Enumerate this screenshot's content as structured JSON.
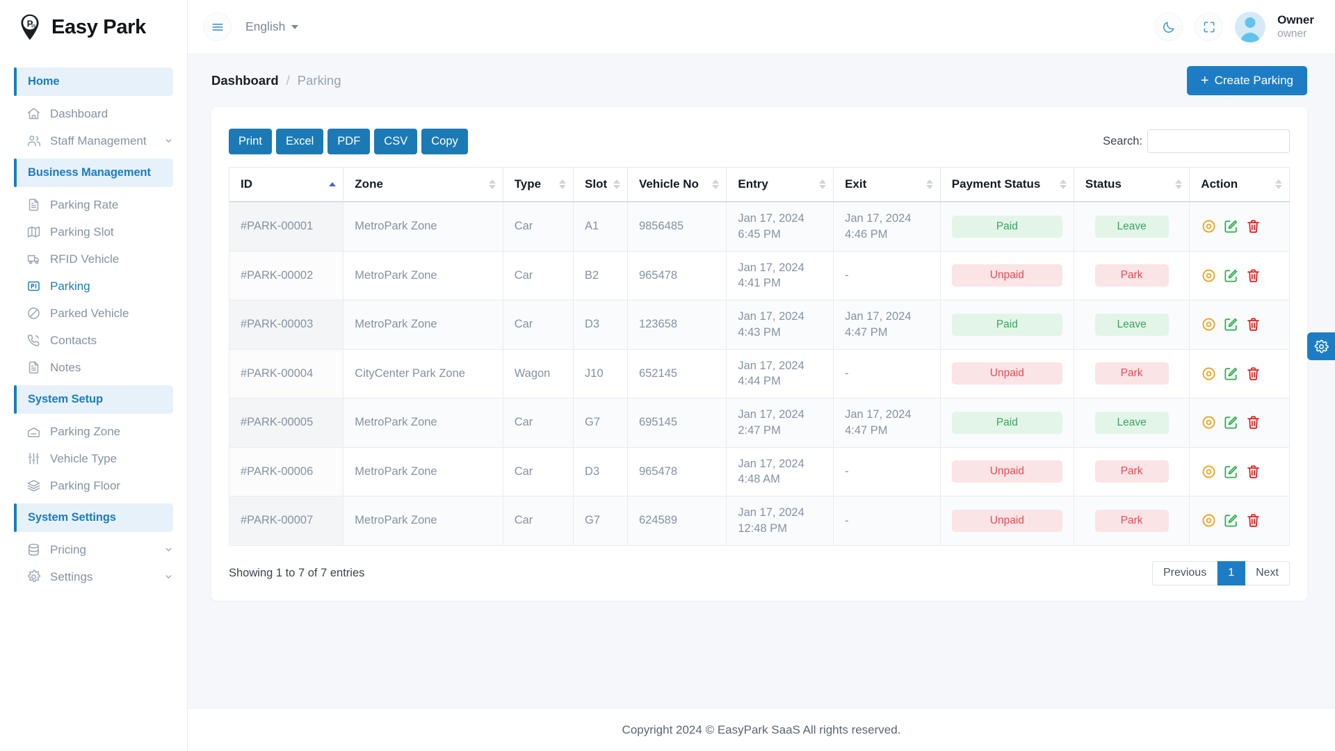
{
  "brand": {
    "name": "Easy Park",
    "logo_icon": "map-pin-parking-icon"
  },
  "sidebar": {
    "sections": [
      {
        "label": "Home",
        "items": [
          {
            "label": "Dashboard",
            "icon": "home-icon",
            "active": false,
            "expandable": false
          },
          {
            "label": "Staff Management",
            "icon": "users-icon",
            "active": false,
            "expandable": true
          }
        ]
      },
      {
        "label": "Business Management",
        "items": [
          {
            "label": "Parking Rate",
            "icon": "file-text-icon",
            "active": false,
            "expandable": false
          },
          {
            "label": "Parking Slot",
            "icon": "map-icon",
            "active": false,
            "expandable": false
          },
          {
            "label": "RFID Vehicle",
            "icon": "truck-icon",
            "active": false,
            "expandable": false
          },
          {
            "label": "Parking",
            "icon": "parking-card-icon",
            "active": true,
            "expandable": false
          },
          {
            "label": "Parked Vehicle",
            "icon": "no-entry-icon",
            "active": false,
            "expandable": false
          },
          {
            "label": "Contacts",
            "icon": "phone-call-icon",
            "active": false,
            "expandable": false
          },
          {
            "label": "Notes",
            "icon": "file-text-icon",
            "active": false,
            "expandable": false
          }
        ]
      },
      {
        "label": "System Setup",
        "items": [
          {
            "label": "Parking Zone",
            "icon": "garage-icon",
            "active": false,
            "expandable": false
          },
          {
            "label": "Vehicle Type",
            "icon": "sliders-icon",
            "active": false,
            "expandable": false
          },
          {
            "label": "Parking Floor",
            "icon": "layers-icon",
            "active": false,
            "expandable": false
          }
        ]
      },
      {
        "label": "System Settings",
        "items": [
          {
            "label": "Pricing",
            "icon": "database-icon",
            "active": false,
            "expandable": true
          },
          {
            "label": "Settings",
            "icon": "gear-icon",
            "active": false,
            "expandable": true
          }
        ]
      }
    ]
  },
  "topbar": {
    "menu_icon": "hamburger-icon",
    "language": "English",
    "dark_mode_icon": "moon-icon",
    "fullscreen_icon": "expand-icon",
    "user": {
      "name": "Owner",
      "role": "owner"
    }
  },
  "page": {
    "breadcrumb": {
      "current": "Dashboard",
      "separator": "/",
      "sub": "Parking"
    },
    "create_button": {
      "plus": "+",
      "label": "Create Parking"
    }
  },
  "table_toolbar": {
    "export_buttons": [
      "Print",
      "Excel",
      "PDF",
      "CSV",
      "Copy"
    ],
    "search_label": "Search:",
    "search_value": "",
    "search_placeholder": ""
  },
  "table": {
    "columns": [
      {
        "label": "ID",
        "sorted": "asc"
      },
      {
        "label": "Zone",
        "sorted": "none"
      },
      {
        "label": "Type",
        "sorted": "none"
      },
      {
        "label": "Slot",
        "sorted": "none"
      },
      {
        "label": "Vehicle No",
        "sorted": "none"
      },
      {
        "label": "Entry",
        "sorted": "none"
      },
      {
        "label": "Exit",
        "sorted": "none"
      },
      {
        "label": "Payment Status",
        "sorted": "none"
      },
      {
        "label": "Status",
        "sorted": "none"
      },
      {
        "label": "Action",
        "sorted": "none"
      }
    ],
    "rows": [
      {
        "id": "#PARK-00001",
        "zone": "MetroPark Zone",
        "type": "Car",
        "slot": "A1",
        "vehicle_no": "9856485",
        "entry_date": "Jan 17, 2024",
        "entry_time": "6:45 PM",
        "exit_date": "Jan 17, 2024",
        "exit_time": "4:46 PM",
        "payment_status": "Paid",
        "payment_ok": true,
        "status": "Leave",
        "status_ok": true
      },
      {
        "id": "#PARK-00002",
        "zone": "MetroPark Zone",
        "type": "Car",
        "slot": "B2",
        "vehicle_no": "965478",
        "entry_date": "Jan 17, 2024",
        "entry_time": "4:41 PM",
        "exit_date": "-",
        "exit_time": "",
        "payment_status": "Unpaid",
        "payment_ok": false,
        "status": "Park",
        "status_ok": false
      },
      {
        "id": "#PARK-00003",
        "zone": "MetroPark Zone",
        "type": "Car",
        "slot": "D3",
        "vehicle_no": "123658",
        "entry_date": "Jan 17, 2024",
        "entry_time": "4:43 PM",
        "exit_date": "Jan 17, 2024",
        "exit_time": "4:47 PM",
        "payment_status": "Paid",
        "payment_ok": true,
        "status": "Leave",
        "status_ok": true
      },
      {
        "id": "#PARK-00004",
        "zone": "CityCenter Park Zone",
        "type": "Wagon",
        "slot": "J10",
        "vehicle_no": "652145",
        "entry_date": "Jan 17, 2024",
        "entry_time": "4:44 PM",
        "exit_date": "-",
        "exit_time": "",
        "payment_status": "Unpaid",
        "payment_ok": false,
        "status": "Park",
        "status_ok": false
      },
      {
        "id": "#PARK-00005",
        "zone": "MetroPark Zone",
        "type": "Car",
        "slot": "G7",
        "vehicle_no": "695145",
        "entry_date": "Jan 17, 2024",
        "entry_time": "2:47 PM",
        "exit_date": "Jan 17, 2024",
        "exit_time": "4:47 PM",
        "payment_status": "Paid",
        "payment_ok": true,
        "status": "Leave",
        "status_ok": true
      },
      {
        "id": "#PARK-00006",
        "zone": "MetroPark Zone",
        "type": "Car",
        "slot": "D3",
        "vehicle_no": "965478",
        "entry_date": "Jan 17, 2024",
        "entry_time": "4:48 AM",
        "exit_date": "-",
        "exit_time": "",
        "payment_status": "Unpaid",
        "payment_ok": false,
        "status": "Park",
        "status_ok": false
      },
      {
        "id": "#PARK-00007",
        "zone": "MetroPark Zone",
        "type": "Car",
        "slot": "G7",
        "vehicle_no": "624589",
        "entry_date": "Jan 17, 2024",
        "entry_time": "12:48 PM",
        "exit_date": "-",
        "exit_time": "",
        "payment_status": "Unpaid",
        "payment_ok": false,
        "status": "Park",
        "status_ok": false
      }
    ],
    "action_icons": [
      "eye-icon",
      "edit-icon",
      "trash-icon"
    ]
  },
  "pagination": {
    "entries_text": "Showing 1 to 7 of 7 entries",
    "previous": "Previous",
    "pages": [
      "1"
    ],
    "current_page": "1",
    "next": "Next"
  },
  "footer": {
    "text": "Copyright 2024 © EasyPark SaaS All rights reserved."
  },
  "floating": {
    "settings_icon": "gear-icon"
  },
  "colors": {
    "accent": "#1d7dc4",
    "export_button": "#1b7ab5",
    "success": "#3aa35e",
    "success_bg": "#e3f5e9",
    "danger": "#ea4a55",
    "danger_bg": "#fbe4e6",
    "action_view": "#f0a31c",
    "action_edit": "#2bb24c",
    "action_delete": "#e62020"
  }
}
